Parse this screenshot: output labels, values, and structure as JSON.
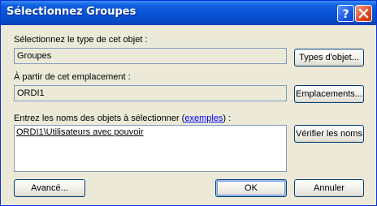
{
  "dialog": {
    "title": "Sélectionnez Groupes",
    "object_type": {
      "label": "Sélectionnez le type de cet objet :",
      "value": "Groupes",
      "button": "Types d'objet..."
    },
    "location": {
      "label": "À partir de cet emplacement :",
      "value": "ORDI1",
      "button": "Emplacements..."
    },
    "names": {
      "label_prefix": "Entrez les noms des objets à sélectionner (",
      "label_link": "exemples",
      "label_suffix": ") :",
      "value": "ORDI1\\Utilisateurs avec pouvoir",
      "button": "Vérifier les noms"
    },
    "buttons": {
      "advanced": "Avancé...",
      "ok": "OK",
      "cancel": "Annuler"
    }
  },
  "colors": {
    "titlebar": "#0a54d8",
    "face": "#ece9d8",
    "field_border": "#7f9db9"
  },
  "icons": [
    "help-icon",
    "close-icon"
  ]
}
